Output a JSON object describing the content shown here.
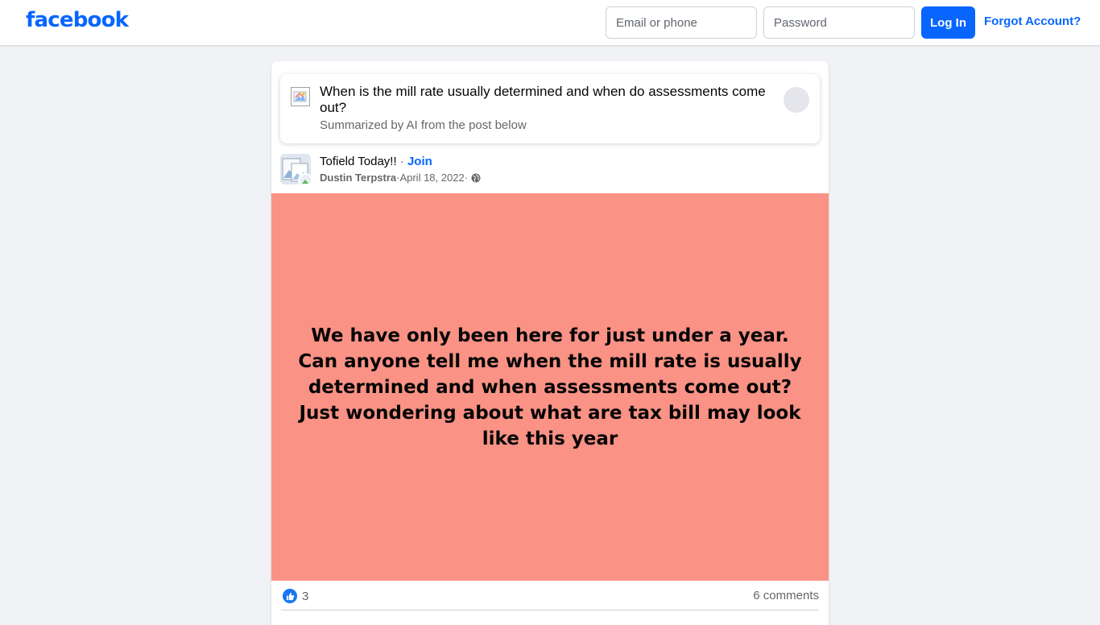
{
  "header": {
    "logo": "facebook",
    "email_placeholder": "Email or phone",
    "password_placeholder": "Password",
    "login_label": "Log In",
    "forgot_label": "Forgot Account?"
  },
  "ai_summary": {
    "question": "When is the mill rate usually determined and when do assessments come out?",
    "subtitle": "Summarized by AI from the post below"
  },
  "post": {
    "group_name": "Tofield Today!!",
    "separator": " · ",
    "join_label": "Join",
    "author": "Dustin Terpstra",
    "date": "April 18, 2022",
    "visibility_icon": "globe-icon",
    "text": "We have only been here for just under a year. Can anyone tell me when the mill rate is usually determined and when assessments come out? Just wondering about what are tax bill may look like this year",
    "background_color": "#fa9285"
  },
  "reactions": {
    "like_count": "3",
    "comments": "6 comments"
  },
  "colors": {
    "brand": "#0866ff",
    "page_bg": "#f0f2f5",
    "secondary_text": "#65676b"
  }
}
